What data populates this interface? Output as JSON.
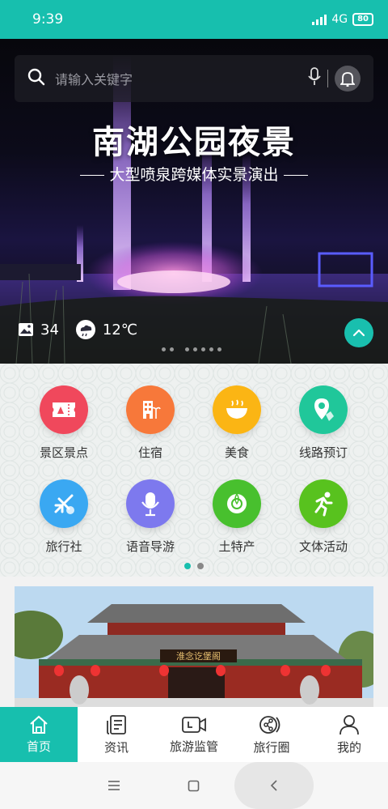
{
  "status": {
    "time": "9:39",
    "network": "4G",
    "battery": "80"
  },
  "search": {
    "placeholder": "请输入关键字"
  },
  "banner": {
    "title": "南湖公园夜景",
    "subtitle": "大型喷泉跨媒体实景演出",
    "photo_count": "34",
    "weather": "12℃"
  },
  "categories": [
    {
      "label": "景区景点",
      "icon": "ticket-icon",
      "color": "#f0485c"
    },
    {
      "label": "住宿",
      "icon": "hotel-icon",
      "color": "#f7783a"
    },
    {
      "label": "美食",
      "icon": "noodle-bowl-icon",
      "color": "#fbb514"
    },
    {
      "label": "线路预订",
      "icon": "route-pin-icon",
      "color": "#20c79a"
    },
    {
      "label": "旅行社",
      "icon": "plane-icon",
      "color": "#3aa8f2"
    },
    {
      "label": "语音导游",
      "icon": "microphone-icon",
      "color": "#7d79ee"
    },
    {
      "label": "土特产",
      "icon": "flower-icon",
      "color": "#48c02e"
    },
    {
      "label": "文体活动",
      "icon": "runner-icon",
      "color": "#58c21e"
    }
  ],
  "card": {
    "sign_text": "淮念讫堡阁"
  },
  "tabs": [
    {
      "label": "首页",
      "icon": "home-icon",
      "active": true
    },
    {
      "label": "资讯",
      "icon": "news-icon",
      "active": false
    },
    {
      "label": "旅游监管",
      "icon": "camera-icon",
      "active": false
    },
    {
      "label": "旅行圈",
      "icon": "share-icon",
      "active": false
    },
    {
      "label": "我的",
      "icon": "user-icon",
      "active": false
    }
  ],
  "colors": {
    "accent": "#17bfae"
  }
}
